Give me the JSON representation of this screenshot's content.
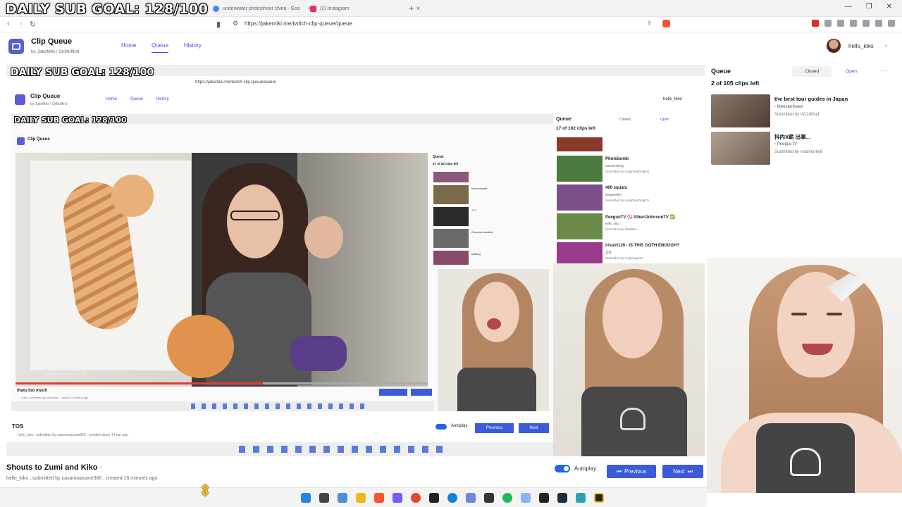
{
  "overlay": {
    "goal_text": "DAILY SUB GOAL: 128/100"
  },
  "browser": {
    "tabs": [
      {
        "label": "underwater photoshoot china - Goo",
        "color": "#4285f4"
      },
      {
        "label": "(2) Instagram",
        "color": "#e1306c"
      }
    ],
    "url": "https://jakemiki.me/twitch-clip-queue/queue"
  },
  "app": {
    "title": "Clip Queue",
    "byline": "by JakeMiki / SirMuffin9",
    "nav": {
      "home": "Home",
      "queue": "Queue",
      "history": "History"
    },
    "user": "hello_kiko"
  },
  "current_clip": {
    "title": "Shouts to Zumi and Kiko",
    "meta": "hello_kiko , submitted by casanovacane360 , created 16 minutes ago"
  },
  "controls": {
    "autoplay": "Autoplay",
    "previous": "Previous",
    "next": "Next"
  },
  "queue": {
    "title": "Queue",
    "closed": "Closed",
    "open": "Open",
    "count": "2 of 105 clips left",
    "items": [
      {
        "title": "the best tour guides in Japan",
        "author": "MeesterKeem",
        "submitted": "Submitted by VG2dGod",
        "color": "#6b5a4b"
      },
      {
        "title": "抖内X跪 出事...",
        "author": "PeeguuTV",
        "submitted": "Submitted by madmarky8",
        "color": "#8a7866"
      }
    ]
  },
  "nested1": {
    "title": "Clip Queue",
    "byline": "by JakeMiki / SirMuffin9",
    "nav": {
      "home": "Home",
      "queue": "Queue",
      "history": "History"
    },
    "user": "hello_kiko",
    "url": "https://jakemiki.me/twitch-clip-queue/queue",
    "queue_title": "Queue",
    "closed": "Closed",
    "open": "Open",
    "count": "17 of 102 clips left",
    "items": [
      {
        "title": "Photobomb",
        "author": "Meowmelody",
        "submitted": "Submitted by LeafySeaDragOn",
        "color": "#4d7a3e"
      },
      {
        "title": "400 squats",
        "author": "BobaeMilkT",
        "submitted": "Submitted by LeafySeaDragOn",
        "color": "#7a4f8a"
      },
      {
        "title": "PeeguuTV 🚫 AlbertJohnsonTV ✅",
        "author": "hello_kiko",
        "submitted": "Submitted by Sieelline",
        "color": "#6a8a4a"
      },
      {
        "title": "irissiri129 - IS THIS GOTH ENOUGH?",
        "author": "艾拉",
        "submitted": "Submitted by ruzgutogamu",
        "color": "#9a3a8a"
      }
    ],
    "clip_title": "TOS",
    "clip_meta": "hello_kiko , submitted by casanovacane360 , created about 1 hour ago",
    "autoplay": "Autoplay",
    "previous": "Previous",
    "next": "Next"
  },
  "nested2": {
    "title": "Clip Queue",
    "queue_title": "Queue",
    "count": "47 of 84 clips left",
    "items": [
      "not a reactor",
      "???",
      "Coconut cracked",
      "knitting"
    ],
    "clip_title": "thats too much",
    "clip_meta": "Zumi , submitted by cryonidau , created 3 months ago",
    "overlay_line1": "Session Subs: 5",
    "overlay_line2": "Latest Tipper: Gonzah - $1"
  }
}
